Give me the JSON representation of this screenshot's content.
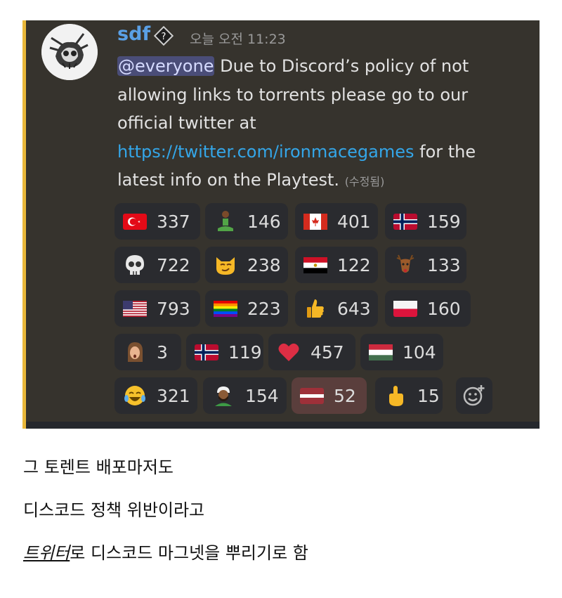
{
  "message": {
    "username": "sdf",
    "timestamp": "오늘 오전 11:23",
    "mention": "@everyone",
    "text_1": " Due to Discord’s policy of not allowing links to torrents please go to our official twitter at ",
    "link": "https://twitter.com/ironmacegames",
    "text_2": " for the latest info on the Playtest.",
    "edited": "(수정됨)"
  },
  "reactions": [
    {
      "icon": "turkey-flag-icon",
      "count": "337"
    },
    {
      "icon": "person-in-lotus-position-icon",
      "count": "146"
    },
    {
      "icon": "canada-flag-icon",
      "count": "401"
    },
    {
      "icon": "norway-flag-icon",
      "count": "159"
    },
    {
      "icon": "skull-icon",
      "count": "722"
    },
    {
      "icon": "smirk-cat-icon",
      "count": "238"
    },
    {
      "icon": "egypt-flag-icon",
      "count": "122"
    },
    {
      "icon": "deer-icon",
      "count": "133"
    },
    {
      "icon": "usa-flag-icon",
      "count": "793"
    },
    {
      "icon": "rainbow-flag-icon",
      "count": "223"
    },
    {
      "icon": "thumbs-up-icon",
      "count": "643"
    },
    {
      "icon": "poland-flag-icon",
      "count": "160"
    },
    {
      "icon": "face-icon",
      "count": "3"
    },
    {
      "icon": "norway-flag-icon",
      "count": "119"
    },
    {
      "icon": "heart-icon",
      "count": "457"
    },
    {
      "icon": "hungary-flag-icon",
      "count": "104"
    },
    {
      "icon": "laughing-tears-icon",
      "count": "321"
    },
    {
      "icon": "man-with-turban-icon",
      "count": "154"
    },
    {
      "icon": "latvia-flag-icon",
      "count": "52",
      "active": true
    },
    {
      "icon": "middle-finger-icon",
      "count": "15"
    }
  ],
  "captions": {
    "line1": "그 토렌트 배포마저도",
    "line2": "디스코드 정책 위반이라고",
    "line3_em": "트위터",
    "line3_rest": "로 디스코드 마그넷을 뿌리기로 함"
  }
}
